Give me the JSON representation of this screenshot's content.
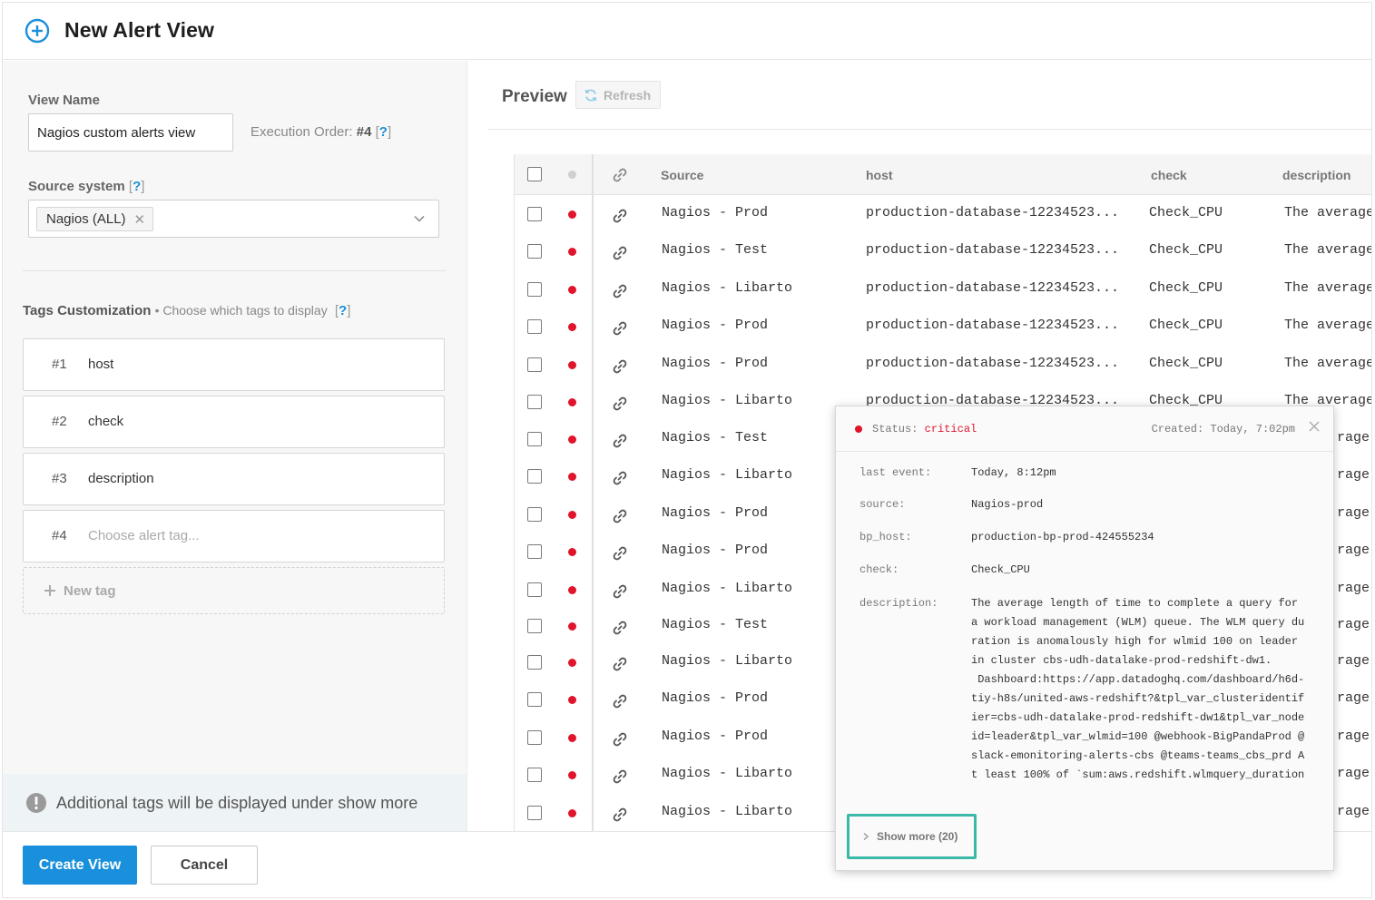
{
  "header": {
    "title": "New Alert View"
  },
  "form": {
    "view_name_label": "View Name",
    "view_name_value": "Nagios custom alerts view",
    "execution_order_label": "Execution Order:",
    "execution_order_value": "#4",
    "help": "?",
    "source_system_label": "Source system",
    "source_chip": "Nagios (ALL)",
    "tags_title": "Tags Customization",
    "tags_subtitle": "• Choose which tags to display",
    "tags": [
      {
        "num": "#1",
        "name": "host"
      },
      {
        "num": "#2",
        "name": "check"
      },
      {
        "num": "#3",
        "name": "description"
      }
    ],
    "tag_placeholder_num": "#4",
    "tag_placeholder": "Choose alert tag...",
    "new_tag_label": "New tag",
    "note": "Additional tags will be displayed under show more"
  },
  "footer": {
    "create_label": "Create View",
    "cancel_label": "Cancel"
  },
  "preview": {
    "title": "Preview",
    "refresh_label": "Refresh",
    "columns": [
      "Source",
      "host",
      "check",
      "description"
    ],
    "rows": [
      {
        "source": "Nagios - Prod",
        "host": "production-database-12234523...",
        "check": "Check_CPU",
        "description": "The average"
      },
      {
        "source": "Nagios - Test",
        "host": "production-database-12234523...",
        "check": "Check_CPU",
        "description": "The average"
      },
      {
        "source": "Nagios - Libarto",
        "host": "production-database-12234523...",
        "check": "Check_CPU",
        "description": "The average"
      },
      {
        "source": "Nagios - Prod",
        "host": "production-database-12234523...",
        "check": "Check_CPU",
        "description": "The average"
      },
      {
        "source": "Nagios - Prod",
        "host": "production-database-12234523...",
        "check": "Check_CPU",
        "description": "The average"
      },
      {
        "source": "Nagios - Libarto",
        "host": "production-database-12234523...",
        "check": "Check_CPU",
        "description": "The average"
      },
      {
        "source": "Nagios - Test",
        "host": "",
        "check": "",
        "description": "rage"
      },
      {
        "source": "Nagios - Libarto",
        "host": "",
        "check": "",
        "description": "rage"
      },
      {
        "source": "Nagios - Prod",
        "host": "",
        "check": "",
        "description": "rage"
      },
      {
        "source": "Nagios - Prod",
        "host": "",
        "check": "",
        "description": "rage"
      },
      {
        "source": "Nagios - Libarto",
        "host": "",
        "check": "",
        "description": "rage"
      },
      {
        "source": "Nagios - Test",
        "host": "",
        "check": "",
        "description": "rage"
      },
      {
        "source": "Nagios - Libarto",
        "host": "",
        "check": "",
        "description": "rage"
      },
      {
        "source": "Nagios - Prod",
        "host": "",
        "check": "",
        "description": "rage"
      },
      {
        "source": "Nagios - Prod",
        "host": "",
        "check": "",
        "description": "rage"
      },
      {
        "source": "Nagios - Libarto",
        "host": "",
        "check": "",
        "description": "rage"
      },
      {
        "source": "Nagios - Libarto",
        "host": "",
        "check": "",
        "description": "rage"
      }
    ]
  },
  "popover": {
    "status_label": "Status:",
    "status_value": "critical",
    "created": "Created: Today, 7:02pm",
    "fields": [
      {
        "key": "last event:",
        "value": "Today, 8:12pm"
      },
      {
        "key": "source:",
        "value": "Nagios-prod"
      },
      {
        "key": "bp_host:",
        "value": "production-bp-prod-424555234"
      },
      {
        "key": "check:",
        "value": "Check_CPU"
      }
    ],
    "description_key": "description:",
    "description_value": "The average length of time to complete a query for a workload management (WLM) queue. The WLM query duration is anomalously high for wlmid 100 on leader in cluster cbs-udh-datalake-prod-redshift-dw1.\n Dashboard:https://app.datadoghq.com/dashboard/h6d-tiy-h8s/united-aws-redshift?&tpl_var_clusteridentifier=cbs-udh-datalake-prod-redshift-dw1&tpl_var_nodeid=leader&tpl_var_wlmid=100 @webhook-BigPandaProd @slack-emonitoring-alerts-cbs @teams-teams_cbs_prd At least 100% of `sum:aws.redshift.wlmquery_duration",
    "show_more": "Show more (20)"
  },
  "colors": {
    "accent": "#1a90dc",
    "critical": "#e0142b",
    "highlight": "#3cb9a6"
  }
}
